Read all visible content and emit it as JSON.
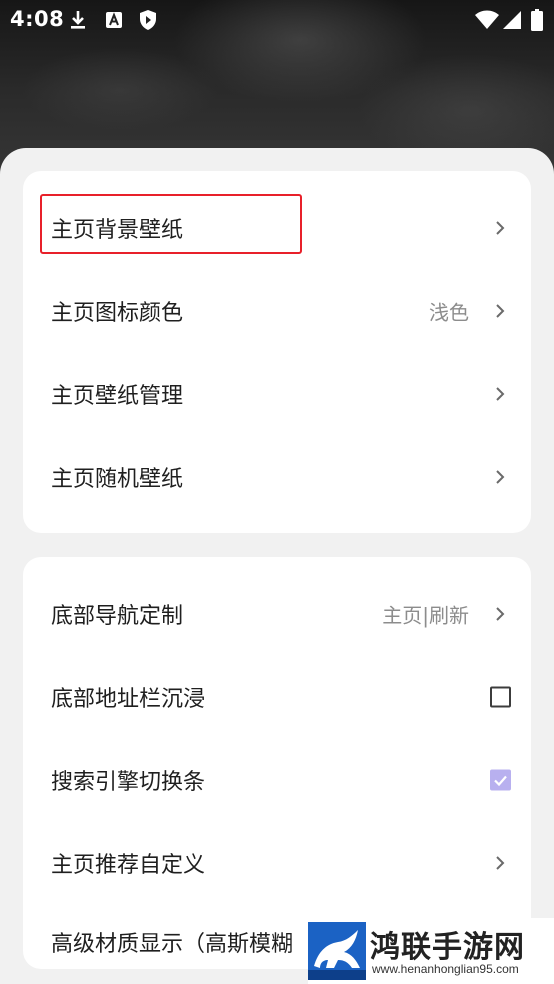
{
  "status_bar": {
    "time": "4:08",
    "left_icons": [
      "download-icon",
      "font-a-icon",
      "shield-icon"
    ],
    "right_icons": [
      "wifi-icon",
      "cellular-signal-icon",
      "battery-icon"
    ]
  },
  "card1": {
    "items": [
      {
        "label": "主页背景壁纸",
        "value": "",
        "control": "chevron",
        "highlighted": true
      },
      {
        "label": "主页图标颜色",
        "value": "浅色",
        "control": "chevron"
      },
      {
        "label": "主页壁纸管理",
        "value": "",
        "control": "chevron"
      },
      {
        "label": "主页随机壁纸",
        "value": "",
        "control": "chevron"
      }
    ]
  },
  "card2": {
    "items": [
      {
        "label": "底部导航定制",
        "value": "主页|刷新",
        "control": "chevron"
      },
      {
        "label": "底部地址栏沉浸",
        "value": "",
        "control": "checkbox",
        "checked": false
      },
      {
        "label": "搜索引擎切换条",
        "value": "",
        "control": "checkbox",
        "checked": true
      },
      {
        "label": "主页推荐自定义",
        "value": "",
        "control": "chevron"
      },
      {
        "label": "高级材质显示（高斯模糊",
        "value": "",
        "control": "none"
      }
    ]
  },
  "watermark": {
    "title": "鸿联手游网",
    "url": "www.henanhonglian95.com"
  },
  "colors": {
    "highlight_border": "#e8202a",
    "checkbox_checked": "#b8b0ef",
    "sheet_background": "#f1f1f1"
  }
}
